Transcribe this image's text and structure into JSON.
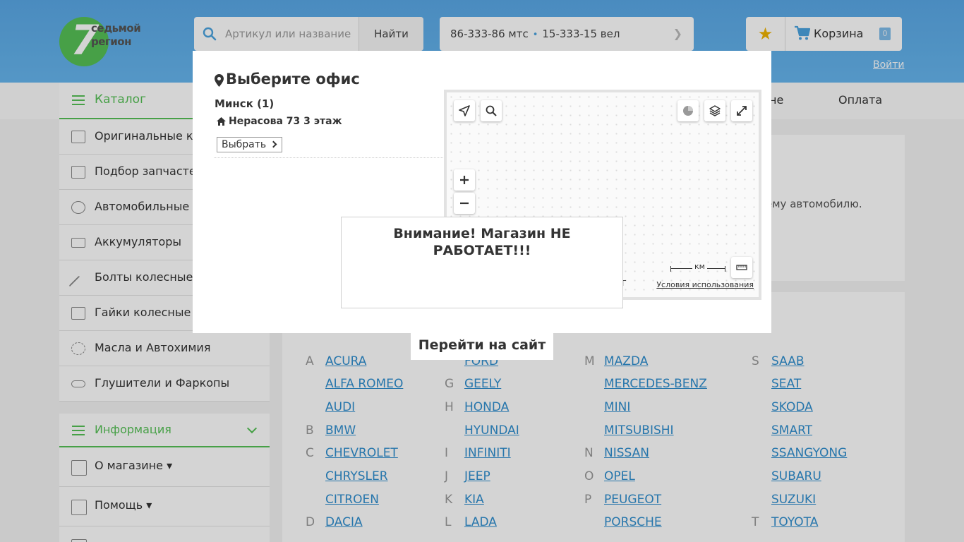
{
  "header": {
    "logo_number": "7",
    "logo_text_line1": "седьмой",
    "logo_text_line2": "регион",
    "search": {
      "placeholder": "Артикул или название",
      "button_label": "Найти"
    },
    "phones": {
      "phone1": "86-333-86 мтс",
      "separator": "•",
      "phone2": "15-333-15 вел"
    },
    "favorites_icon": "star-icon",
    "cart": {
      "label": "Корзина",
      "count": "0"
    },
    "login_label": "Войти"
  },
  "nav": {
    "catalog_label": "Каталог",
    "partial_item": "не",
    "payment_label": "Оплата"
  },
  "sidebar": {
    "items": [
      {
        "label": "Оригинальные каталоги",
        "icon": "box-icon"
      },
      {
        "label": "Подбор запчастей",
        "icon": "box-icon"
      },
      {
        "label": "Автомобильные лампы",
        "icon": "bulb-icon"
      },
      {
        "label": "Аккумуляторы",
        "icon": "battery-icon"
      },
      {
        "label": "Болты колесные",
        "icon": "bolt-icon"
      },
      {
        "label": "Гайки колесные",
        "icon": "box-icon"
      },
      {
        "label": "Масла и Автохимия",
        "icon": "oil-icon"
      },
      {
        "label": "Глушители и Фаркопы",
        "icon": "muffler-icon"
      }
    ],
    "info_label": "Информация",
    "info_items": [
      {
        "label": "О магазине ▾"
      },
      {
        "label": "Помощь ▾"
      }
    ]
  },
  "main": {
    "partial_text": "ему автомобилю.",
    "brands": [
      {
        "letter": "A",
        "name": "ACURA"
      },
      {
        "letter": "",
        "name": "ALFA ROMEO"
      },
      {
        "letter": "",
        "name": "AUDI"
      },
      {
        "letter": "B",
        "name": "BMW"
      },
      {
        "letter": "C",
        "name": "CHEVROLET"
      },
      {
        "letter": "",
        "name": "CHRYSLER"
      },
      {
        "letter": "",
        "name": "CITROEN"
      },
      {
        "letter": "D",
        "name": "DACIA"
      },
      {
        "letter": "",
        "name": "FORD"
      },
      {
        "letter": "G",
        "name": "GEELY"
      },
      {
        "letter": "H",
        "name": "HONDA"
      },
      {
        "letter": "",
        "name": "HYUNDAI"
      },
      {
        "letter": "I",
        "name": "INFINITI"
      },
      {
        "letter": "J",
        "name": "JEEP"
      },
      {
        "letter": "K",
        "name": "KIA"
      },
      {
        "letter": "L",
        "name": "LADA"
      },
      {
        "letter": "M",
        "name": "MAZDA"
      },
      {
        "letter": "",
        "name": "MERCEDES-BENZ"
      },
      {
        "letter": "",
        "name": "MINI"
      },
      {
        "letter": "",
        "name": "MITSUBISHI"
      },
      {
        "letter": "N",
        "name": "NISSAN"
      },
      {
        "letter": "O",
        "name": "OPEL"
      },
      {
        "letter": "P",
        "name": "PEUGEOT"
      },
      {
        "letter": "",
        "name": "PORSCHE"
      },
      {
        "letter": "S",
        "name": "SAAB"
      },
      {
        "letter": "",
        "name": "SEAT"
      },
      {
        "letter": "",
        "name": "SKODA"
      },
      {
        "letter": "",
        "name": "SMART"
      },
      {
        "letter": "",
        "name": "SSANGYONG"
      },
      {
        "letter": "",
        "name": "SUBARU"
      },
      {
        "letter": "",
        "name": "SUZUKI"
      },
      {
        "letter": "T",
        "name": "TOYOTA"
      }
    ]
  },
  "office_modal": {
    "title": "Выберите офис",
    "city": "Минск (1)",
    "address": "Нерасова 73 3 этаж",
    "choose_label": "Выбрать",
    "map": {
      "scale_label": "км",
      "terms_label": "Условия использования",
      "partial_copyright": "Г"
    }
  },
  "alert": {
    "message": "Внимание! Магазин НЕ РАБОТАЕТ!!!",
    "goto_label": "Перейти на сайт"
  },
  "colors": {
    "header_blue": "#5aa8e6",
    "brand_green": "#56c156",
    "link_blue": "#2f8fcf"
  }
}
